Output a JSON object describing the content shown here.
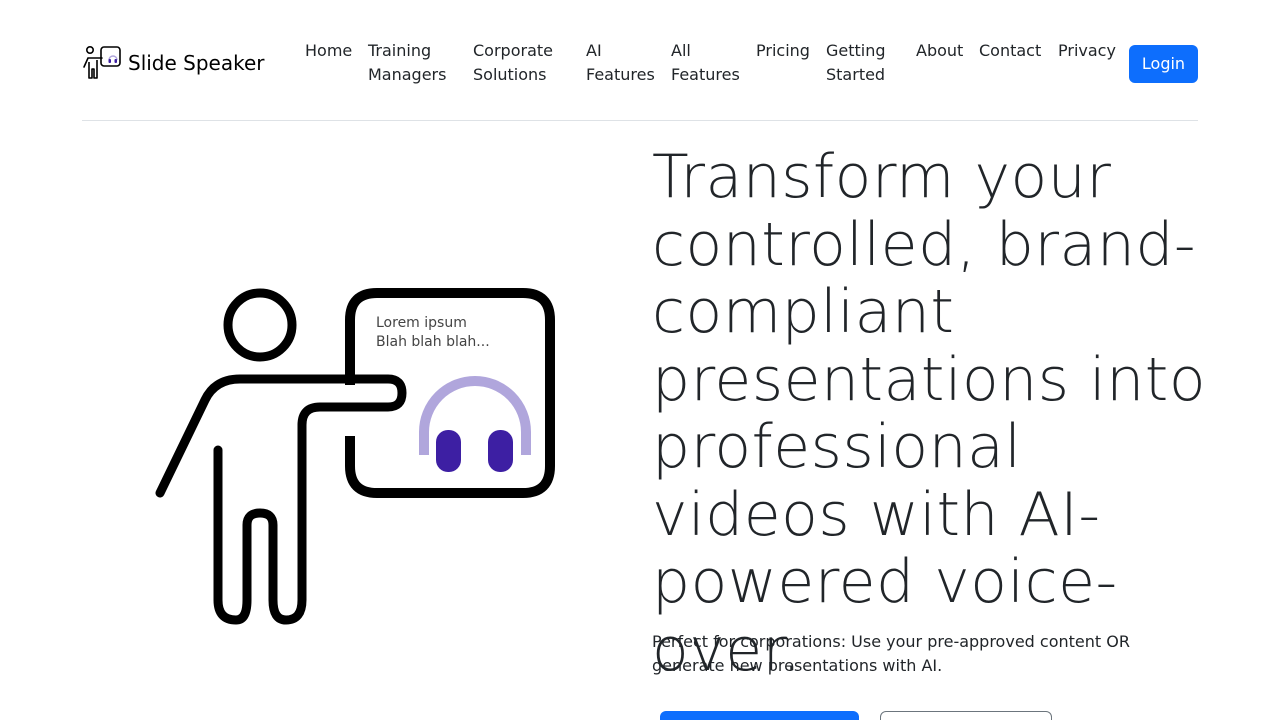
{
  "brand": {
    "name": "Slide Speaker",
    "icon": "presenter-logo-icon"
  },
  "nav": {
    "items": [
      {
        "label": "Home"
      },
      {
        "label": "Training Managers"
      },
      {
        "label": "Corporate Solutions"
      },
      {
        "label": "AI Features"
      },
      {
        "label": "All Features"
      },
      {
        "label": "Pricing"
      },
      {
        "label": "Getting Started"
      },
      {
        "label": "About"
      },
      {
        "label": "Contact"
      },
      {
        "label": "Privacy"
      }
    ],
    "login_label": "Login"
  },
  "hero": {
    "illustration": {
      "icon": "presenter-headphones-icon",
      "board_line1": "Lorem ipsum",
      "board_line2": "Blah blah blah..."
    },
    "title": "Transform your controlled, brand-compliant presentations into professional videos with AI-powered voice-over.",
    "lead": "Perfect for corporations: Use your pre-approved content OR generate new presentations with AI."
  },
  "colors": {
    "primary": "#0d6efd",
    "headphone_band": "#b0a6dc",
    "headphone_cups": "#3d1fa3",
    "text": "#212529"
  }
}
